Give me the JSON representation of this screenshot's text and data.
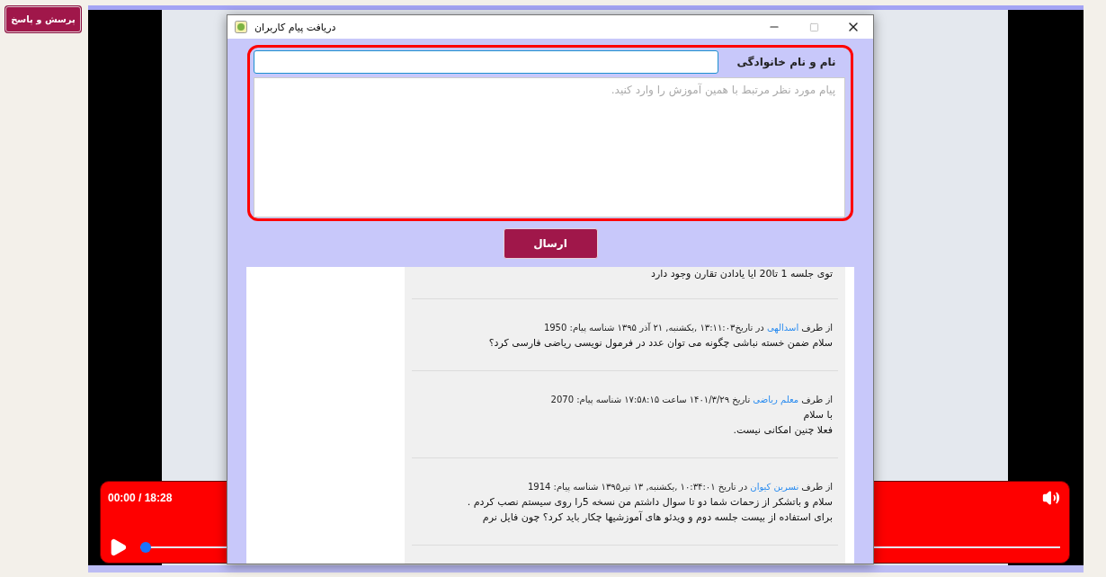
{
  "side_button": {
    "label": "پرسش و پاسخ"
  },
  "player": {
    "time": "00:00 / 18:28",
    "level": 0
  },
  "dialog": {
    "title": "دریافت پیام کاربران",
    "name_label": "نام و نام خانوادگی",
    "message_placeholder": "پیام مورد نظر مرتبط با همین آموزش را وارد کنید.",
    "submit": "ارسال",
    "messages": [
      {
        "body": [
          "توی جلسه 1 تا20 ایا یادادن تقارن وجود دارد"
        ]
      },
      {
        "prefix": "از طرف",
        "author": "اسدالهی",
        "suffix": "در تاریخ۱۳:۱۱:۰۳ ,یکشنبه, ۲۱ آذر ۱۳۹۵ شناسه پیام: 1950",
        "body": [
          "سلام ضمن خسته نباشی چگونه می توان عدد در فرمول نویسی ریاضی فارسی کرد؟"
        ]
      },
      {
        "prefix": "از طرف",
        "author": "معلم ریاضی",
        "suffix": "تاریخ ۱۴۰۱/۳/۲۹ ساعت ۱۷:۵۸:۱۵ شناسه پیام: 2070",
        "body": [
          "با سلام",
          "فعلا چنین امکانی نیست."
        ]
      },
      {
        "prefix": "از طرف",
        "author": "نسرین کیوان",
        "suffix": "در تاریخ ۱۰:۳۴:۰۱ ,یکشنبه, ۱۳ تیر۱۳۹۵ شناسه پیام: 1914",
        "body": [
          "سلام و باتشکر از زحمات شما دو تا سوال داشتم من نسخه 5را روی سیستم نصب کردم .",
          "برای استفاده از بیست جلسه دوم و ویدئو های آموزشیها چکار باید کرد؟ چون فایل نرم"
        ]
      }
    ]
  }
}
